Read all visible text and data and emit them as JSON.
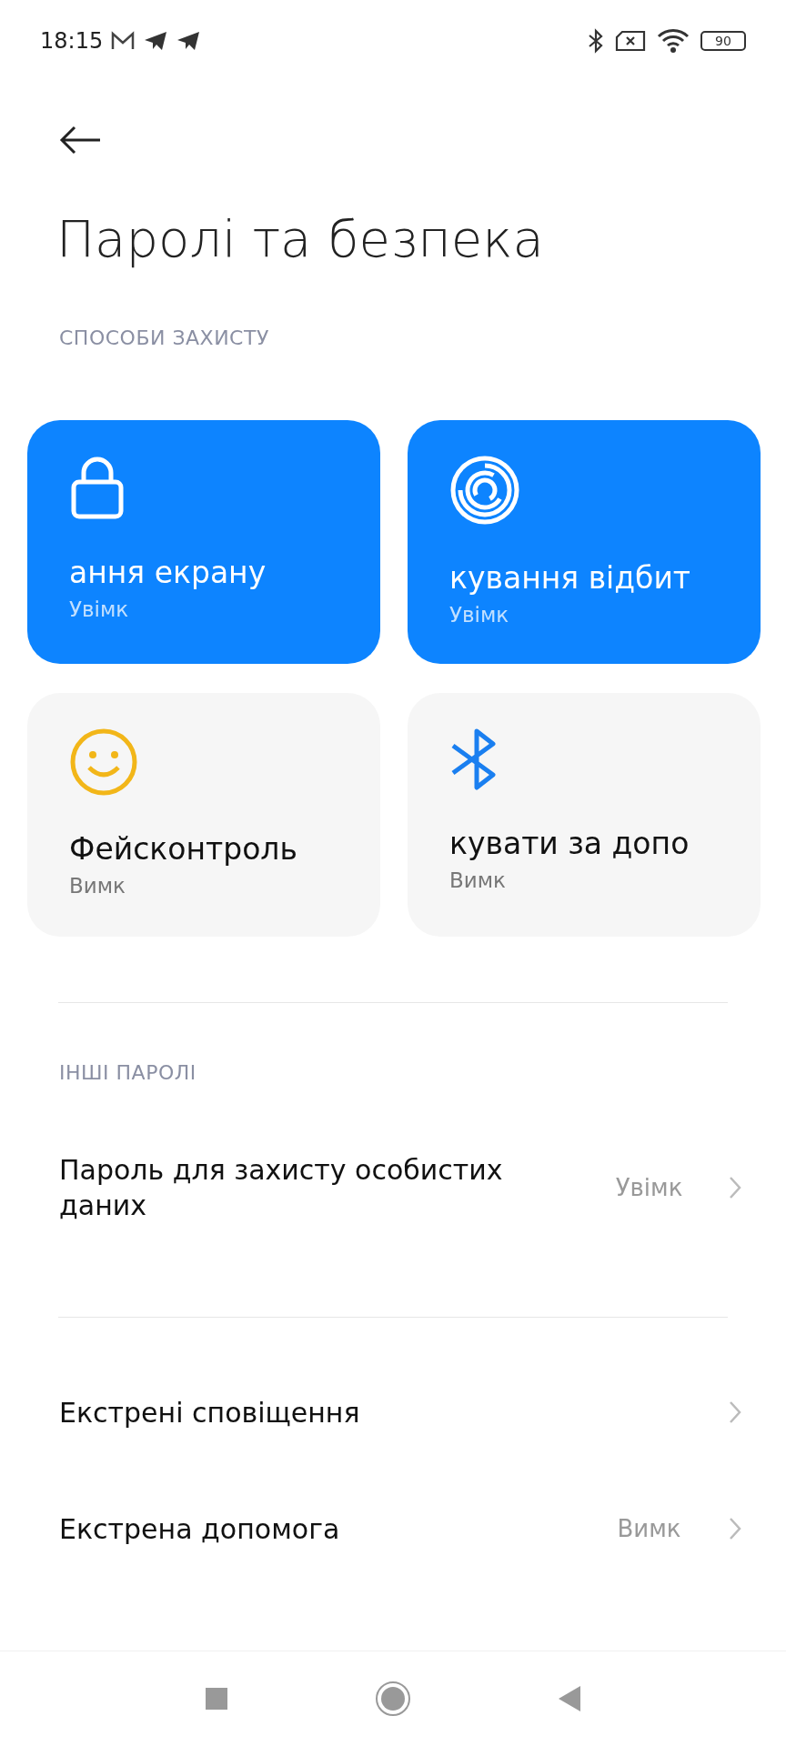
{
  "status_bar": {
    "time": "18:15",
    "battery": "90"
  },
  "title": "Паролі та безпека",
  "sections": [
    {
      "header": "СПОСОБИ ЗАХИСТУ",
      "cards": [
        {
          "kind": "lock",
          "title": "ання екрану",
          "status": "Увімк",
          "on": true
        },
        {
          "kind": "fingerprint",
          "title": "кування відбит",
          "status": "Увімк",
          "on": true
        },
        {
          "kind": "face",
          "title": "Фейсконтроль",
          "status": "Вимк",
          "on": false
        },
        {
          "kind": "bluetooth",
          "title": "кувати за допо",
          "status": "Вимк",
          "on": false
        }
      ]
    },
    {
      "header": "ІНШІ ПАРОЛІ",
      "rows": [
        {
          "title": "Пароль для захисту особистих даних",
          "value": "Увімк"
        }
      ]
    },
    {
      "rows": [
        {
          "title": "Екстрені сповіщення"
        },
        {
          "title": "Екстрена допомога",
          "value": "Вимк"
        }
      ]
    }
  ]
}
